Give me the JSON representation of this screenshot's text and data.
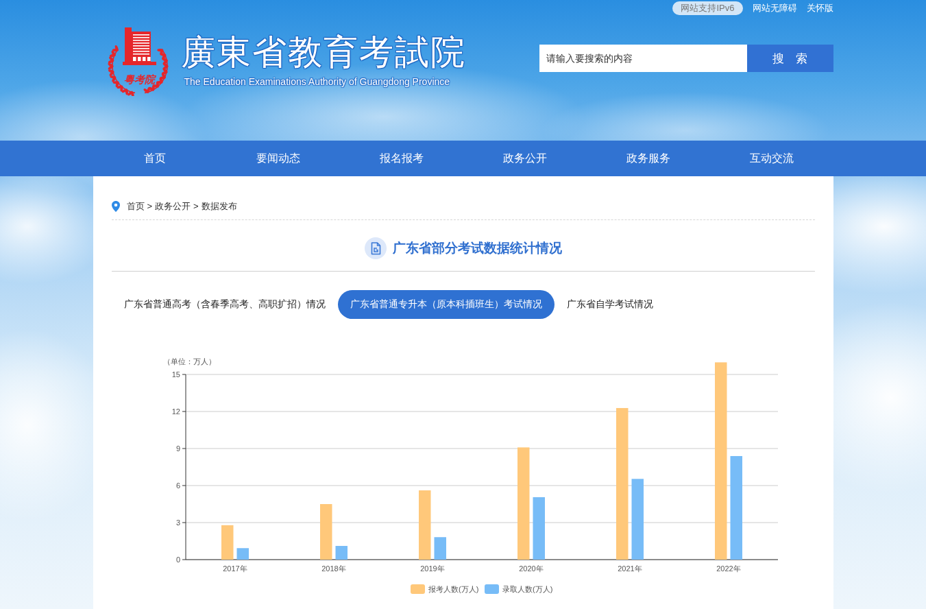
{
  "header": {
    "top_links": [
      {
        "kind": "badge",
        "label": "网站支持IPv6"
      },
      {
        "kind": "link",
        "label": "网站无障碍"
      },
      {
        "kind": "link",
        "label": "关怀版"
      }
    ],
    "logo": {
      "emblem_text": "粵考院",
      "title": "廣東省教育考試院",
      "subtitle": "The Education Examinations Authority of Guangdong Province"
    },
    "search": {
      "placeholder": "请输入要搜索的内容",
      "button": "搜 索"
    }
  },
  "nav": {
    "items": [
      {
        "label": "首页"
      },
      {
        "label": "要闻动态"
      },
      {
        "label": "报名报考"
      },
      {
        "label": "政务公开"
      },
      {
        "label": "政务服务"
      },
      {
        "label": "互动交流"
      }
    ]
  },
  "breadcrumb": [
    {
      "label": "首页"
    },
    {
      "separator": ">",
      "label": "政务公开"
    },
    {
      "separator": ">",
      "label": "数据发布"
    }
  ],
  "section": {
    "title": "广东省部分考试数据统计情况"
  },
  "tabs": [
    {
      "label": "广东省普通高考（含春季高考、高职扩招）情况",
      "selected": false
    },
    {
      "label": "广东省普通专升本（原本科插班生）考试情况",
      "selected": true
    },
    {
      "label": "广东省自学考试情况",
      "selected": false
    }
  ],
  "chart": {
    "chart_data": {
      "type": "bar",
      "ylabel": "（单位：万人）",
      "categories": [
        "2017年",
        "2018年",
        "2019年",
        "2020年",
        "2021年",
        "2022年"
      ],
      "series": [
        {
          "name": "报考人数(万人)",
          "color": "#ffc87a",
          "values": [
            2.79,
            4.5,
            5.61,
            9.09,
            12.28,
            15.98
          ]
        },
        {
          "name": "录取人数(万人)",
          "color": "#77bcf7",
          "values": [
            0.93,
            1.11,
            1.82,
            5.06,
            6.54,
            8.39
          ]
        }
      ],
      "ylim": [
        0,
        16
      ],
      "yticks": [
        0,
        3,
        6,
        9,
        12,
        15
      ],
      "grid": true,
      "legend": true
    }
  }
}
